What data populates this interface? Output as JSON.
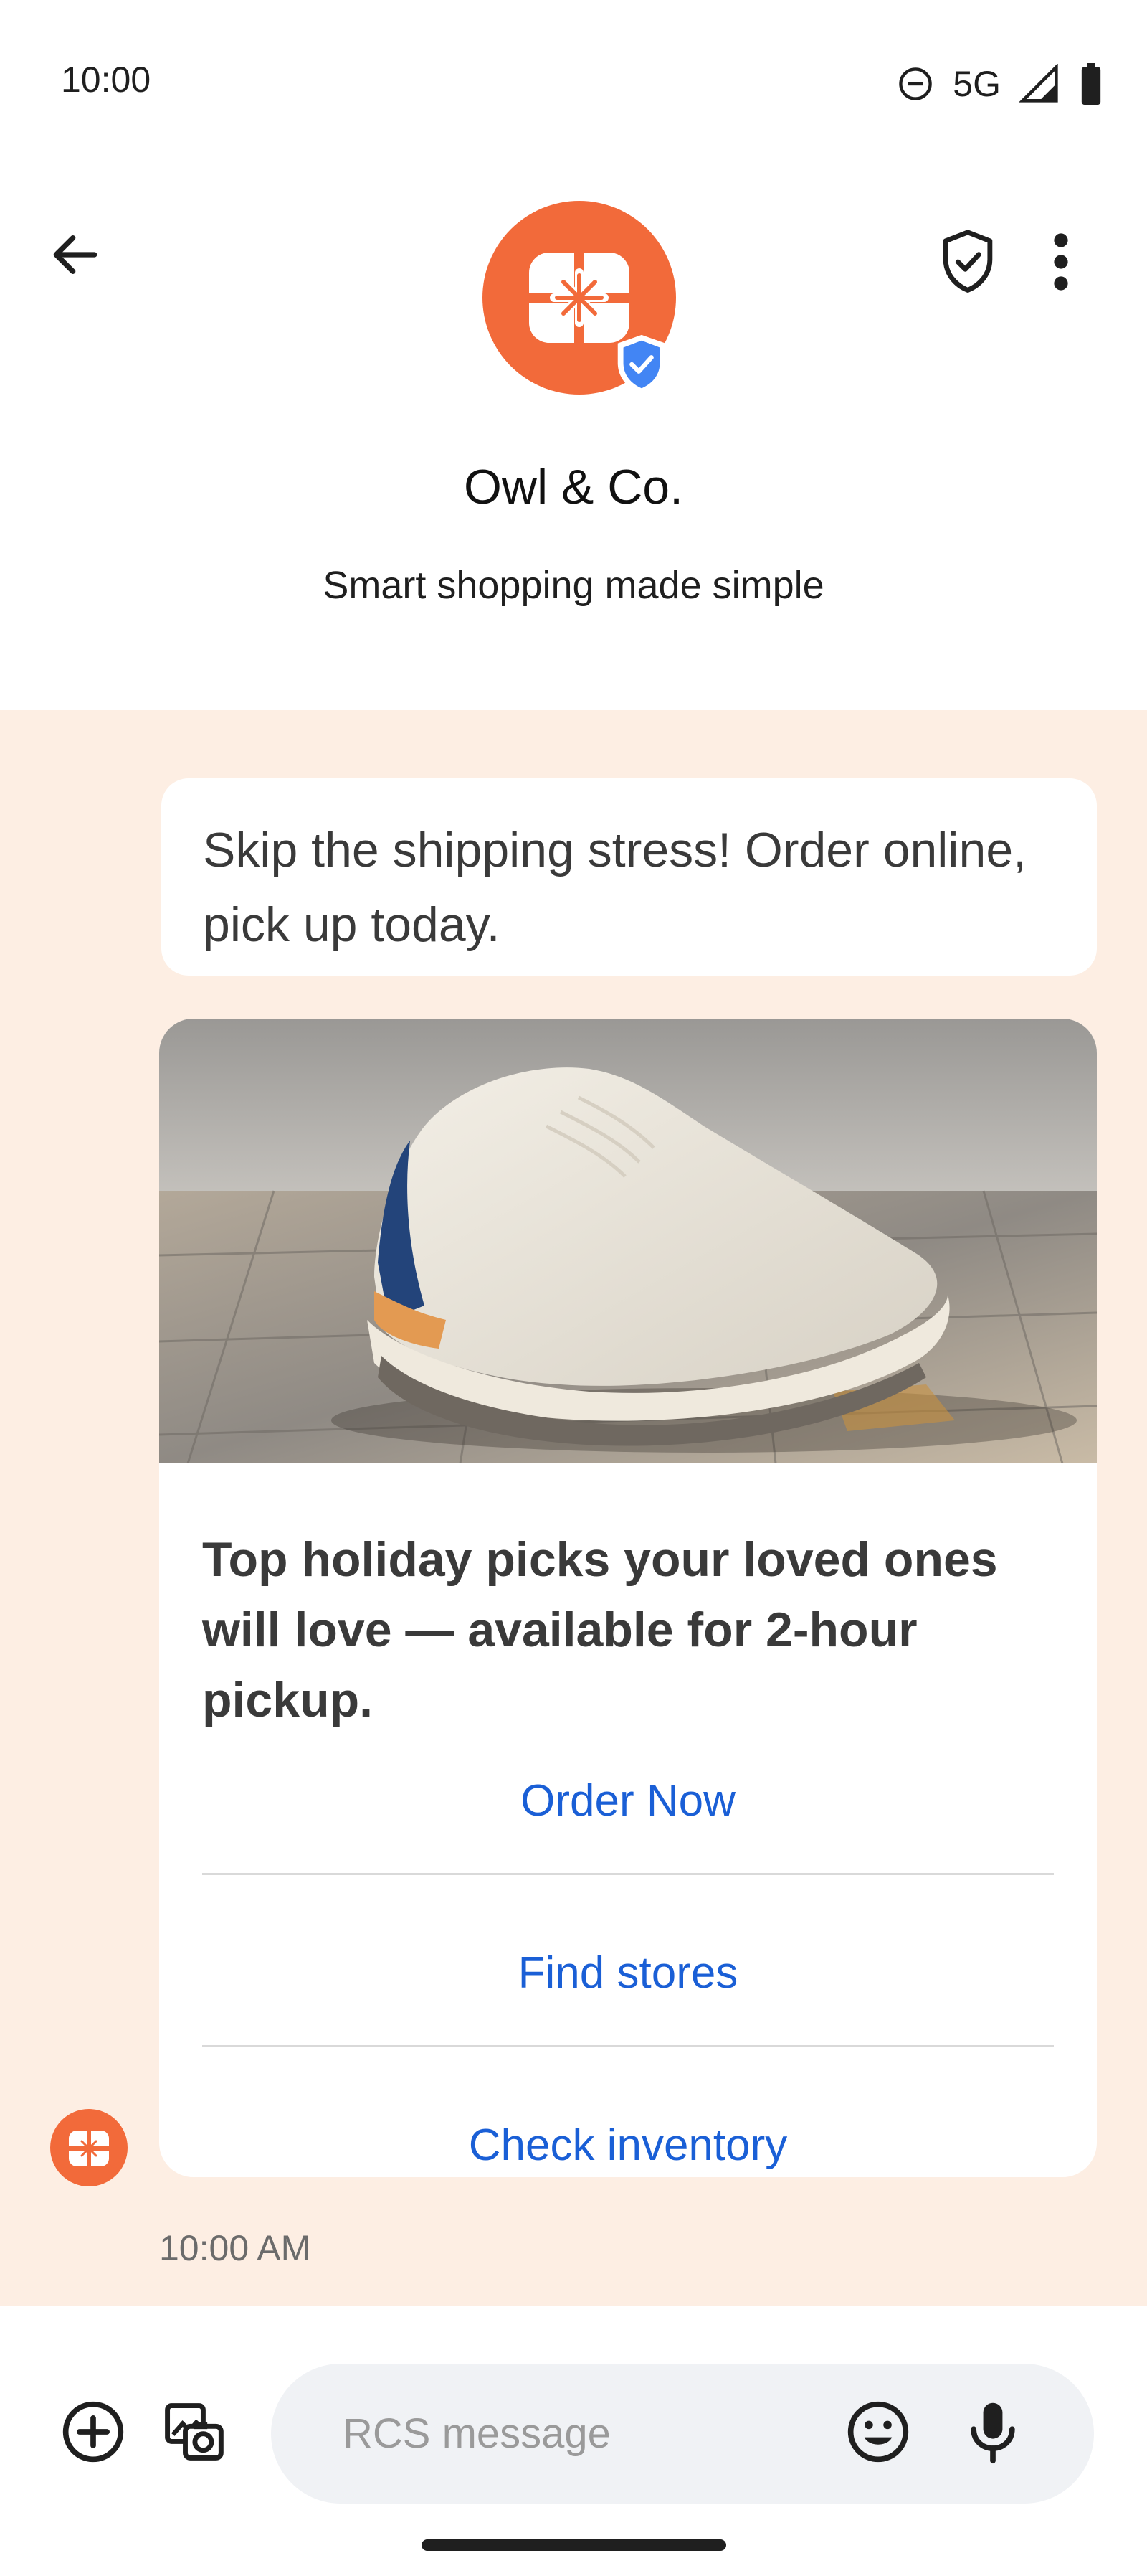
{
  "status_bar": {
    "time": "10:00",
    "network": "5G",
    "icons": [
      "do-not-disturb-icon",
      "signal-icon",
      "battery-icon"
    ]
  },
  "header": {
    "brand_name": "Owl & Co.",
    "tagline": "Smart shopping made simple",
    "icons": [
      "back-arrow-icon",
      "shield-check-icon",
      "more-vert-icon",
      "verified-badge-icon"
    ],
    "brand_color": "#f26a3a",
    "verified_color": "#4285f4"
  },
  "conversation": {
    "background_color": "#fdeee3",
    "message_text": "Skip the shipping stress! Order online, pick up today.",
    "card": {
      "image_alt": "sneaker-photo",
      "title": "Top holiday picks your loved ones will love — available for 2-hour pickup.",
      "actions": [
        "Order Now",
        "Find stores",
        "Check inventory"
      ],
      "action_color": "#1a5fd6"
    },
    "timestamp": "10:00 AM"
  },
  "composer": {
    "placeholder": "RCS message",
    "icons": [
      "add-circle-icon",
      "gallery-icon",
      "emoji-icon",
      "mic-icon"
    ]
  }
}
